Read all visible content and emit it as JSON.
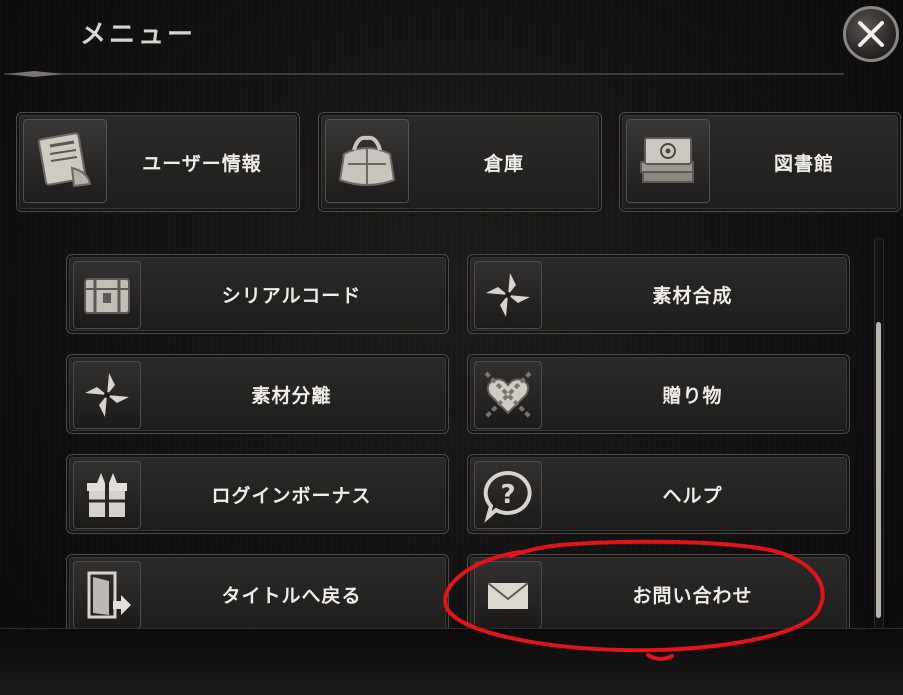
{
  "header": {
    "title": "メニュー"
  },
  "close_button": {
    "icon": "close-icon"
  },
  "top_row": [
    {
      "label": "ユーザー情報",
      "icon": "scroll-document-icon"
    },
    {
      "label": "倉庫",
      "icon": "bag-icon"
    },
    {
      "label": "図書館",
      "icon": "book-icon"
    }
  ],
  "menu_items": [
    {
      "label": "シリアルコード",
      "icon": "treasure-chest-icon"
    },
    {
      "label": "素材合成",
      "icon": "pinwheel-icon"
    },
    {
      "label": "素材分離",
      "icon": "pinwheel-icon"
    },
    {
      "label": "贈り物",
      "icon": "chained-heart-icon"
    },
    {
      "label": "ログインボーナス",
      "icon": "gift-box-icon"
    },
    {
      "label": "ヘルプ",
      "icon": "question-bubble-icon"
    },
    {
      "label": "タイトルへ戻る",
      "icon": "exit-door-icon"
    },
    {
      "label": "お問い合わせ",
      "icon": "envelope-icon"
    }
  ],
  "annotation": {
    "color": "#e0141a",
    "target": "お問い合わせ"
  }
}
